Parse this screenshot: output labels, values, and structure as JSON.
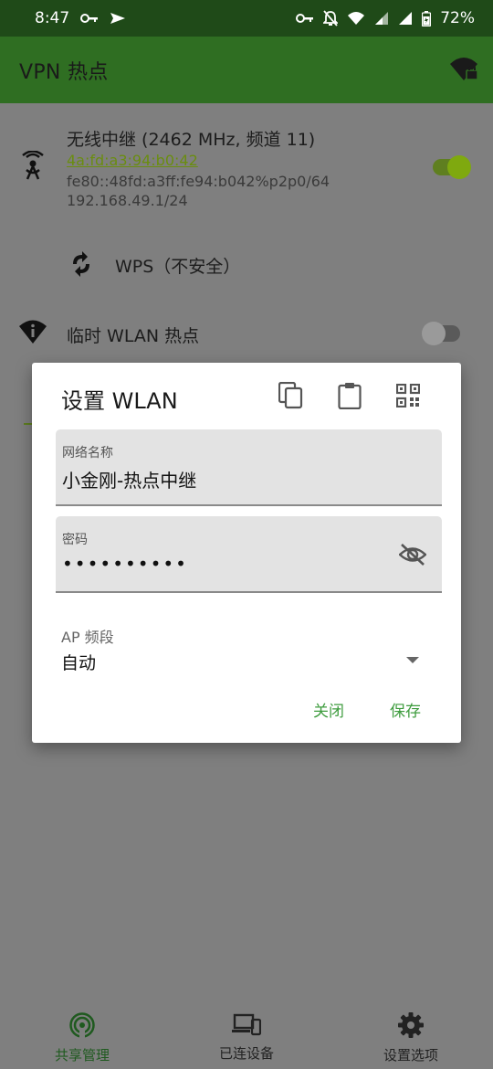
{
  "status_bar": {
    "time": "8:47",
    "battery": "72%",
    "left_icons": [
      "key-icon",
      "paper-plane-icon"
    ],
    "right_icons": [
      "key-icon",
      "notifications-off-icon",
      "wifi-x-icon",
      "signal-x-icon",
      "signal-icon",
      "battery-charging-icon"
    ]
  },
  "app_bar": {
    "title": "VPN 热点",
    "icon": "wifi-lock-icon"
  },
  "repeater": {
    "icon": "wifi-tower-icon",
    "title": "无线中继 (2462 MHz, 频道 11)",
    "mac": "4a:fd:a3:94:b0:42",
    "ipv6": "fe80::48fd:a3ff:fe94:b042%p2p0/64",
    "ipv4": "192.168.49.1/24",
    "enabled": true
  },
  "wps": {
    "icon": "wps-icon",
    "label": "WPS（不安全）"
  },
  "temp_hotspot": {
    "icon": "wifi-info-icon",
    "label": "临时 WLAN 热点",
    "enabled": false
  },
  "dialog": {
    "title": "设置 WLAN",
    "tools": [
      "copy-icon",
      "clipboard-icon",
      "qr-code-icon"
    ],
    "ssid_label": "网络名称",
    "ssid_value": "小金刚-热点中继",
    "password_label": "密码",
    "password_value": "••••••••••",
    "password_toggle_icon": "visibility-off-icon",
    "band_label": "AP 频段",
    "band_value": "自动",
    "close_label": "关闭",
    "save_label": "保存"
  },
  "bottom_nav": {
    "items": [
      {
        "label": "共享管理",
        "icon": "hotspot-icon",
        "active": true
      },
      {
        "label": "已连设备",
        "icon": "devices-icon",
        "active": false
      },
      {
        "label": "设置选项",
        "icon": "gear-icon",
        "active": false
      }
    ]
  },
  "colors": {
    "status_bar": "#1f4a18",
    "app_bar": "#2f6e22",
    "scrim": "#7f7f7f",
    "accent": "#3e9c3e",
    "switch_on": "#7fa90f",
    "nav_active": "#1f5a1f"
  }
}
